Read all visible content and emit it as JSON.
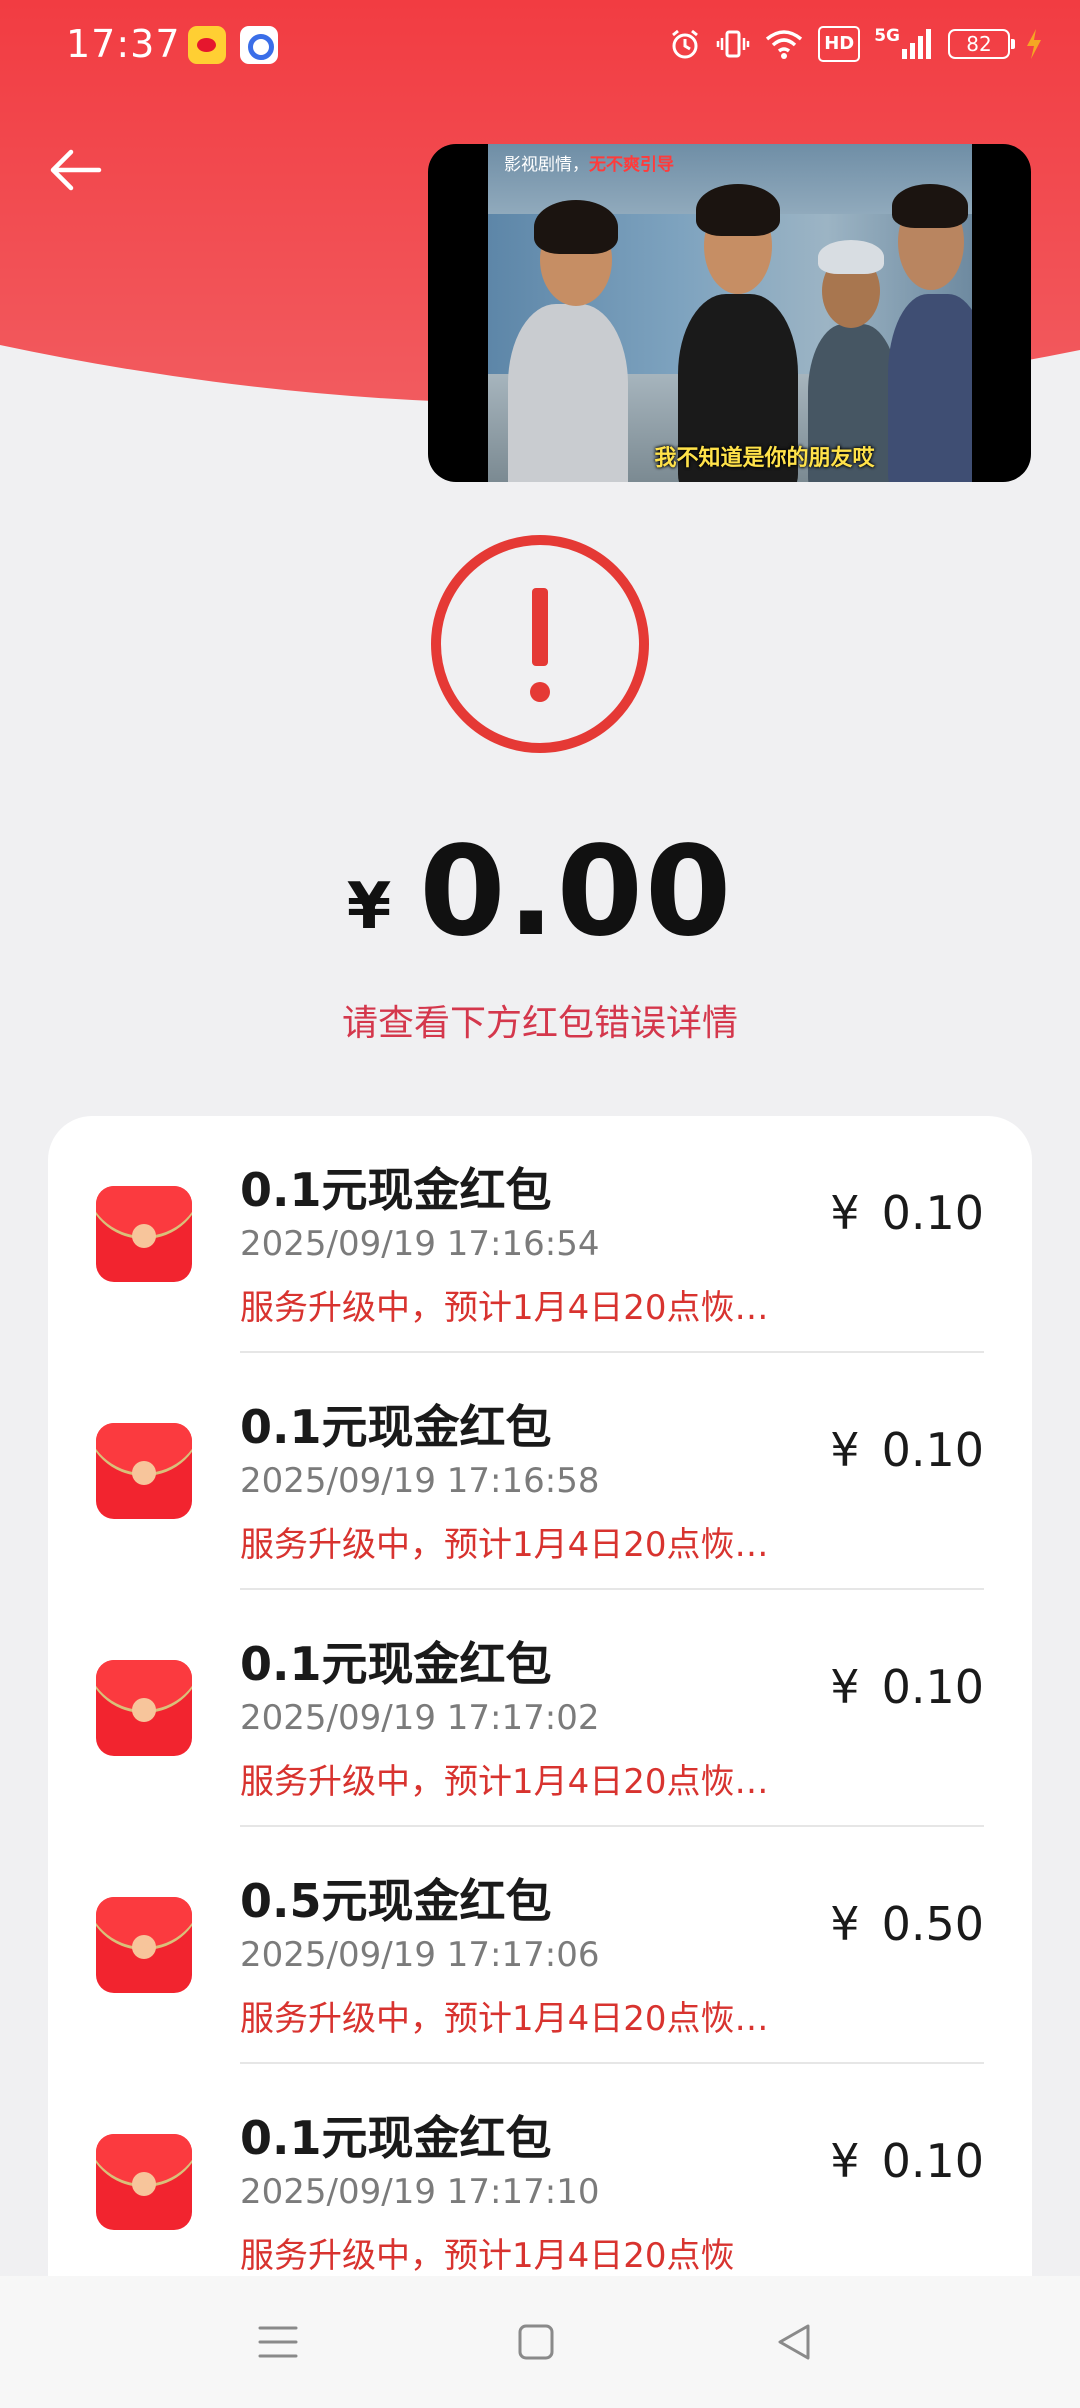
{
  "status_bar": {
    "time": "17:37",
    "hd": "HD",
    "network": "5G",
    "battery": "82"
  },
  "video": {
    "title_prefix": "影视剧情，",
    "title_highlight": "无不爽引导",
    "subtitle": "我不知道是你的朋友哎"
  },
  "result": {
    "currency": "¥",
    "amount": "0.00",
    "hint": "请查看下方红包错误详情"
  },
  "items": [
    {
      "title": "0.1元现金红包",
      "time": "2025/09/19 17:16:54",
      "status": "服务升级中，预计1月4日20点恢…",
      "currency": "¥",
      "amount": "0.10"
    },
    {
      "title": "0.1元现金红包",
      "time": "2025/09/19 17:16:58",
      "status": "服务升级中，预计1月4日20点恢…",
      "currency": "¥",
      "amount": "0.10"
    },
    {
      "title": "0.1元现金红包",
      "time": "2025/09/19 17:17:02",
      "status": "服务升级中，预计1月4日20点恢…",
      "currency": "¥",
      "amount": "0.10"
    },
    {
      "title": "0.5元现金红包",
      "time": "2025/09/19 17:17:06",
      "status": "服务升级中，预计1月4日20点恢…",
      "currency": "¥",
      "amount": "0.50"
    },
    {
      "title": "0.1元现金红包",
      "time": "2025/09/19 17:17:10",
      "status": "服务升级中，预计1月4日20点恢",
      "currency": "¥",
      "amount": "0.10"
    }
  ],
  "colors": {
    "header_red": "#f2454a",
    "alert_red": "#e53935",
    "status_text_red": "#d8332f"
  },
  "icons": {
    "back": "arrow-left-icon",
    "alert": "exclamation-circle-icon",
    "envelope": "red-envelope-icon",
    "nav_menu": "menu-icon",
    "nav_home": "square-icon",
    "nav_back": "triangle-back-icon"
  }
}
